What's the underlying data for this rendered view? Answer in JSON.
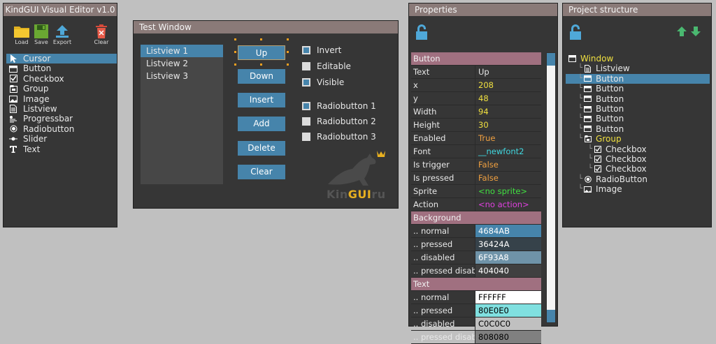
{
  "editor": {
    "title": "KindGUI Visual Editor v1.0",
    "tools": [
      {
        "label": "Load",
        "icon": "folder-icon"
      },
      {
        "label": "Save",
        "icon": "floppy-icon"
      },
      {
        "label": "Export",
        "icon": "upload-arrow-icon"
      },
      {
        "label": "Clear",
        "icon": "trash-icon"
      }
    ],
    "widgets": [
      {
        "label": "Cursor",
        "icon": "cursor-icon",
        "selected": true
      },
      {
        "label": "Button",
        "icon": "button-icon"
      },
      {
        "label": "Checkbox",
        "icon": "checkbox-icon"
      },
      {
        "label": "Group",
        "icon": "group-icon"
      },
      {
        "label": "Image",
        "icon": "image-icon"
      },
      {
        "label": "Listview",
        "icon": "listview-icon"
      },
      {
        "label": "Progressbar",
        "icon": "progressbar-icon"
      },
      {
        "label": "Radiobutton",
        "icon": "radiobutton-icon"
      },
      {
        "label": "Slider",
        "icon": "slider-icon"
      },
      {
        "label": "Text",
        "icon": "text-icon"
      }
    ]
  },
  "testwin": {
    "title": "Test Window",
    "listview": [
      "Listview 1",
      "Listview 2",
      "Listview 3"
    ],
    "buttons": [
      "Up",
      "Down",
      "Insert",
      "Add",
      "Delete",
      "Clear"
    ],
    "checkboxes": [
      {
        "label": "Invert",
        "checked": true
      },
      {
        "label": "Editable",
        "checked": false
      },
      {
        "label": "Visible",
        "checked": true
      }
    ],
    "radios": [
      {
        "label": "Radiobutton 1",
        "checked": true
      },
      {
        "label": "Radiobutton 2",
        "checked": false
      },
      {
        "label": "Radiobutton 3",
        "checked": false
      }
    ],
    "logo": {
      "part1": "Kin",
      "part2": "GUI",
      "part3": "ru"
    }
  },
  "props": {
    "title": "Properties",
    "rows": [
      {
        "type": "header",
        "label": "Button"
      },
      {
        "key": "Text",
        "value": "Up",
        "color": "#e8e8e8"
      },
      {
        "key": "x",
        "value": "208",
        "color": "#f0e040"
      },
      {
        "key": "y",
        "value": "48",
        "color": "#f0e040"
      },
      {
        "key": "Width",
        "value": "94",
        "color": "#f0e040"
      },
      {
        "key": "Height",
        "value": "30",
        "color": "#f0e040"
      },
      {
        "key": "Enabled",
        "value": "True",
        "color": "#f0a040"
      },
      {
        "key": "Font",
        "value": "__newfont2",
        "color": "#40d8e0"
      },
      {
        "key": "Is trigger",
        "value": "False",
        "color": "#f0a040"
      },
      {
        "key": "Is pressed",
        "value": "False",
        "color": "#f0a040"
      },
      {
        "key": "Sprite",
        "value": "<no sprite>",
        "color": "#40e040"
      },
      {
        "key": "Action",
        "value": "<no action>",
        "color": "#e040e0"
      },
      {
        "type": "header",
        "label": "Background"
      },
      {
        "key": ".. normal",
        "value": "4684AB",
        "bg": "#4684ab",
        "color": "#ffffff"
      },
      {
        "key": ".. pressed",
        "value": "36424A",
        "bg": "#36424a",
        "color": "#ffffff"
      },
      {
        "key": ".. disabled",
        "value": "6F93A8",
        "bg": "#6f93a8",
        "color": "#ffffff"
      },
      {
        "key": ".. pressed disab",
        "value": "404040",
        "bg": "#404040",
        "color": "#ffffff"
      },
      {
        "type": "header",
        "label": "Text"
      },
      {
        "key": ".. normal",
        "value": "FFFFFF",
        "bg": "#ffffff",
        "color": "#000000"
      },
      {
        "key": ".. pressed",
        "value": "80E0E0",
        "bg": "#80e0e0",
        "color": "#000000"
      },
      {
        "key": ".. disabled",
        "value": "C0C0C0",
        "bg": "#c0c0c0",
        "color": "#000000"
      },
      {
        "key": ".. pressed disab",
        "value": "808080",
        "bg": "#808080",
        "color": "#000000"
      }
    ]
  },
  "proj": {
    "title": "Project structure",
    "tree": [
      {
        "label": "Window",
        "icon": "window-icon",
        "depth": 0,
        "color": "#f0e040"
      },
      {
        "label": "Listview",
        "icon": "listview-icon",
        "depth": 1
      },
      {
        "label": "Button",
        "icon": "button-icon",
        "depth": 1,
        "selected": true
      },
      {
        "label": "Button",
        "icon": "button-icon",
        "depth": 1
      },
      {
        "label": "Button",
        "icon": "button-icon",
        "depth": 1
      },
      {
        "label": "Button",
        "icon": "button-icon",
        "depth": 1
      },
      {
        "label": "Button",
        "icon": "button-icon",
        "depth": 1
      },
      {
        "label": "Button",
        "icon": "button-icon",
        "depth": 1
      },
      {
        "label": "Group",
        "icon": "group-icon",
        "depth": 1,
        "color": "#f0e040"
      },
      {
        "label": "Checkbox",
        "icon": "checkbox-icon",
        "depth": 2
      },
      {
        "label": "Checkbox",
        "icon": "checkbox-icon",
        "depth": 2
      },
      {
        "label": "Checkbox",
        "icon": "checkbox-icon",
        "depth": 2
      },
      {
        "label": "RadioButton",
        "icon": "radiobutton-icon",
        "depth": 1
      },
      {
        "label": "Image",
        "icon": "image-icon",
        "depth": 1
      }
    ]
  },
  "colors": {
    "accent": "#4684ab",
    "titlebar": "#8a7a78",
    "panel": "#363636",
    "section": "#a07080"
  }
}
